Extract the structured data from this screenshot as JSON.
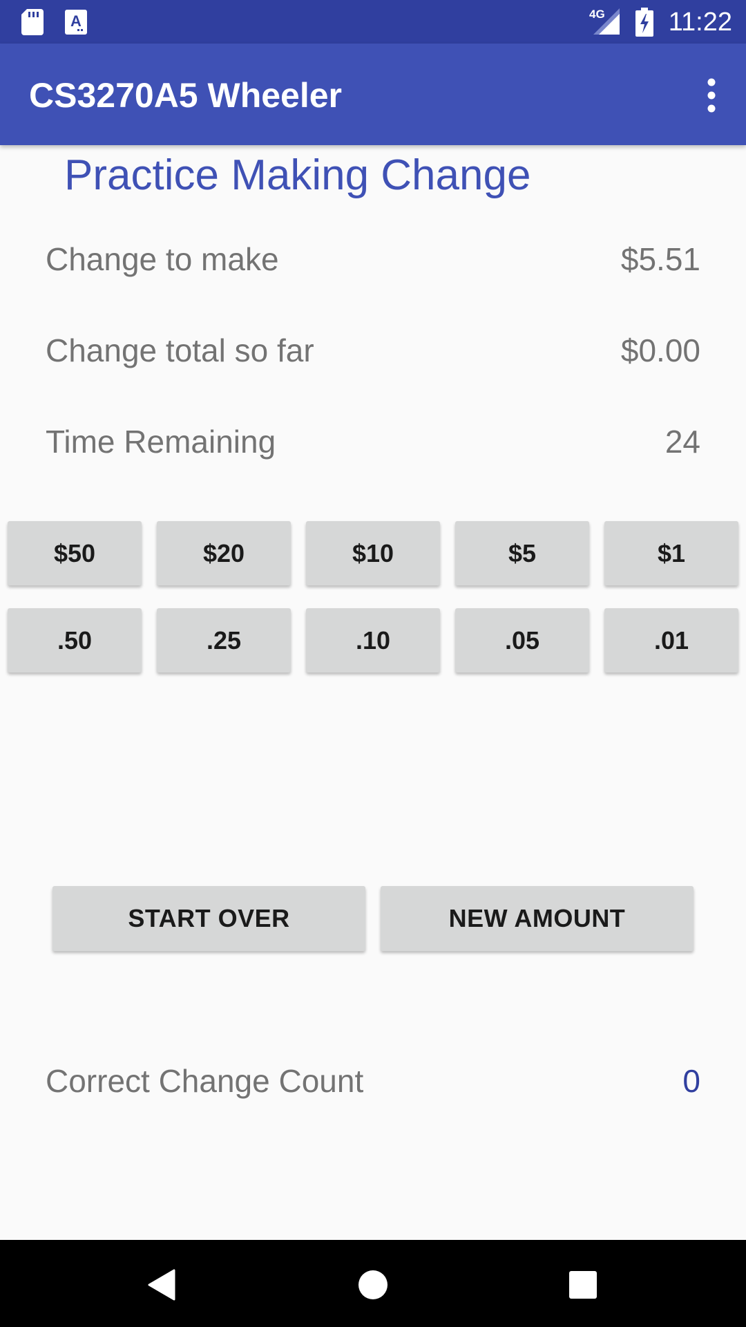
{
  "status_bar": {
    "time": "11:22",
    "network": "4G",
    "icons": [
      "sd-card-icon",
      "a-notification-icon",
      "signal-icon",
      "battery-charging-icon"
    ]
  },
  "app_bar": {
    "title": "CS3270A5 Wheeler",
    "menu_icon": "more-vert-icon"
  },
  "heading": "Practice Making Change",
  "rows": {
    "change_to_make": {
      "label": "Change to make",
      "value": "$5.51"
    },
    "change_total": {
      "label": "Change total so far",
      "value": "$0.00"
    },
    "time_remaining": {
      "label": "Time Remaining",
      "value": "24"
    }
  },
  "bills": [
    "$50",
    "$20",
    "$10",
    "$5",
    "$1"
  ],
  "coins": [
    ".50",
    ".25",
    ".10",
    ".05",
    ".01"
  ],
  "actions": {
    "start_over": "START OVER",
    "new_amount": "NEW AMOUNT"
  },
  "correct_count": {
    "label": "Correct Change Count",
    "value": "0"
  },
  "nav_bar": {
    "icons": [
      "back-icon",
      "home-icon",
      "recents-icon"
    ]
  },
  "colors": {
    "status_bar": "#303f9f",
    "app_bar": "#3f51b5",
    "accent": "#3f51b5",
    "button": "#d6d7d7",
    "label_text": "#737373",
    "count_value": "#303f9f"
  }
}
